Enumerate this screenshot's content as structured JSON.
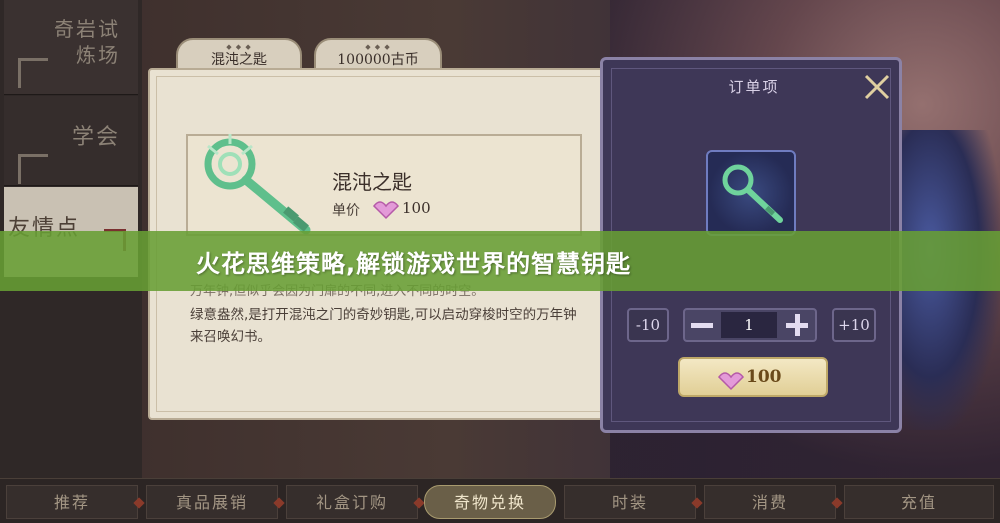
{
  "left_menu": {
    "items": [
      {
        "label": "奇岩试炼场"
      },
      {
        "label": "学会"
      },
      {
        "label": "友情点"
      }
    ]
  },
  "top_buttons": {
    "item": "混沌之匙",
    "currency": "100000古币"
  },
  "item_detail": {
    "name": "混沌之匙",
    "unit_label": "单价",
    "unit_price": "100",
    "partial_text": "万年钟,但似乎会因为门扉的不同,进入不同的时空。",
    "description": "绿意盎然,是打开混沌之门的奇妙钥匙,可以启动穿梭时空的万年钟来召唤幻书。"
  },
  "order": {
    "title": "订单项",
    "minus10": "-10",
    "plus10": "+10",
    "quantity": "1",
    "total": "100"
  },
  "banner": {
    "text": "火花思维策略,解锁游戏世界的智慧钥匙"
  },
  "tabs": [
    {
      "label": "推荐"
    },
    {
      "label": "真品展销"
    },
    {
      "label": "礼盒订购"
    },
    {
      "label": "奇物兑换",
      "active": true
    },
    {
      "label": "时装"
    },
    {
      "label": "消费"
    },
    {
      "label": "充值"
    }
  ],
  "colors": {
    "banner": "#689e34",
    "order_panel": "#3e3757",
    "detail_panel": "#e9e2d2"
  }
}
